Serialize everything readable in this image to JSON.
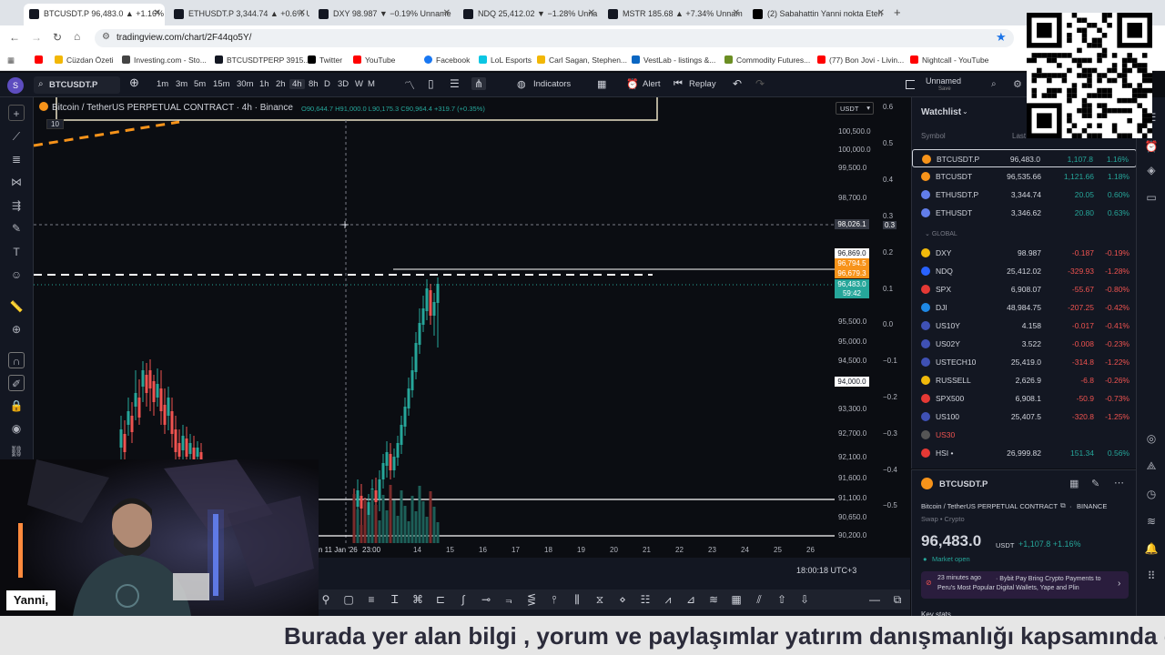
{
  "browser": {
    "tabs": [
      {
        "label": "BTCUSDT.P 96,483.0 ▲ +1.16%",
        "active": true
      },
      {
        "label": "ETHUSDT.P 3,344.74 ▲ +0.6% U"
      },
      {
        "label": "DXY 98.987 ▼ −0.19% Unname"
      },
      {
        "label": "NDQ 25,412.02 ▼ −1.28% Unna"
      },
      {
        "label": "MSTR 185.68 ▲ +7.34% Unnam"
      },
      {
        "label": "(2) Sabahattin Yanni nokta Eteh"
      }
    ],
    "url": "tradingview.com/chart/2F44qo5Y/",
    "bookmarks": [
      "Cüzdan Özeti",
      "Investing.com - Sto...",
      "BTCUSDTPERP 3915...",
      "Twitter",
      "YouTube",
      "Facebook",
      "LoL Esports",
      "Carl Sagan, Stephen...",
      "VestLab - listings &...",
      "Commodity Futures...",
      "(77) Bon Jovi - Livin...",
      "Nightcall - YouTube"
    ]
  },
  "toolbar": {
    "symbol": "BTCUSDT.P",
    "intervals": [
      "1m",
      "3m",
      "5m",
      "15m",
      "30m",
      "1h",
      "2h",
      "4h",
      "8h",
      "D",
      "3D",
      "W",
      "M"
    ],
    "active_interval": "4h",
    "indicators": "Indicators",
    "alert": "Alert",
    "replay": "Replay",
    "layout_name": "Unnamed",
    "layout_sub": "Save"
  },
  "legend": {
    "title": "Bitcoin / TetherUS PERPETUAL CONTRACT · 4h · Binance",
    "ohlc": "O90,644.7 H91,000.0 L90,175.3 C90,964.4 +319.7 (+0.35%)",
    "sub": "10"
  },
  "price_axis": {
    "currency": "USDT",
    "labels": [
      "100,500.0",
      "100,000.0",
      "99,500.0",
      "98,700.0",
      "95,500.0",
      "95,000.0",
      "94,500.0",
      "93,300.0",
      "92,700.0",
      "92,100.0",
      "91,600.0",
      "91,100.0",
      "90,650.0",
      "90,200.0"
    ],
    "crosshair": "98,026.1",
    "level_a": "96,869.0",
    "level_b": "96,794.5",
    "level_c": "96,679.3",
    "last": "96,483.0",
    "countdown": "59:42",
    "level_d": "94,000.0"
  },
  "right_scale": [
    "0.6",
    "0.5",
    "0.4",
    "0.3",
    "0.3",
    "0.2",
    "0.1",
    "0.0",
    "−0.1",
    "−0.2",
    "−0.3",
    "−0.4",
    "−0.5"
  ],
  "time_axis": {
    "labels": [
      "n 11 Jan '26",
      "23:00",
      "14",
      "15",
      "16",
      "17",
      "18",
      "19",
      "20",
      "21",
      "22",
      "23",
      "24",
      "25",
      "26"
    ],
    "clock": "18:00:18 UTC+3"
  },
  "watchlist": {
    "title": "Watchlist",
    "col_symbol": "Symbol",
    "col_last": "Last",
    "group_global": "GLOBAL",
    "rows": [
      {
        "sym": "BTCUSDT.P",
        "last": "96,483.0",
        "chg": "1,107.8",
        "pct": "1.16%",
        "dir": "up",
        "color": "#f7931a"
      },
      {
        "sym": "BTCUSDT",
        "last": "96,535.66",
        "chg": "1,121.66",
        "pct": "1.18%",
        "dir": "up",
        "color": "#f7931a"
      },
      {
        "sym": "ETHUSDT.P",
        "last": "3,344.74",
        "chg": "20.05",
        "pct": "0.60%",
        "dir": "up",
        "color": "#627eea"
      },
      {
        "sym": "ETHUSDT",
        "last": "3,346.62",
        "chg": "20.80",
        "pct": "0.63%",
        "dir": "up",
        "color": "#627eea"
      }
    ],
    "global_rows": [
      {
        "sym": "DXY",
        "last": "98.987",
        "chg": "-0.187",
        "pct": "-0.19%",
        "dir": "dn",
        "color": "#f0b90b"
      },
      {
        "sym": "NDQ",
        "last": "25,412.02",
        "chg": "-329.93",
        "pct": "-1.28%",
        "dir": "dn",
        "color": "#2962ff"
      },
      {
        "sym": "SPX",
        "last": "6,908.07",
        "chg": "-55.67",
        "pct": "-0.80%",
        "dir": "dn",
        "color": "#e53935"
      },
      {
        "sym": "DJI",
        "last": "48,984.75",
        "chg": "-207.25",
        "pct": "-0.42%",
        "dir": "dn",
        "color": "#1e88e5"
      },
      {
        "sym": "US10Y",
        "last": "4.158",
        "chg": "-0.017",
        "pct": "-0.41%",
        "dir": "dn",
        "color": "#3f51b5"
      },
      {
        "sym": "US02Y",
        "last": "3.522",
        "chg": "-0.008",
        "pct": "-0.23%",
        "dir": "dn",
        "color": "#3f51b5"
      },
      {
        "sym": "USTECH10",
        "last": "25,419.0",
        "chg": "-314.8",
        "pct": "-1.22%",
        "dir": "dn",
        "color": "#3f51b5"
      },
      {
        "sym": "RUSSELL",
        "last": "2,626.9",
        "chg": "-6.8",
        "pct": "-0.26%",
        "dir": "dn",
        "color": "#f0b90b"
      },
      {
        "sym": "SPX500",
        "last": "6,908.1",
        "chg": "-50.9",
        "pct": "-0.73%",
        "dir": "dn",
        "color": "#e53935"
      },
      {
        "sym": "US100",
        "last": "25,407.5",
        "chg": "-320.8",
        "pct": "-1.25%",
        "dir": "dn",
        "color": "#3f51b5"
      },
      {
        "sym": "US30",
        "last": "",
        "chg": "",
        "pct": "",
        "dir": "dn",
        "color": "#555"
      },
      {
        "sym": "HSI •",
        "last": "26,999.82",
        "chg": "151.34",
        "pct": "0.56%",
        "dir": "up",
        "color": "#e53935"
      }
    ]
  },
  "detail": {
    "symbol": "BTCUSDT.P",
    "full_name": "Bitcoin / TetherUS PERPETUAL CONTRACT",
    "exchange": "BINANCE",
    "type": "Swap • Crypto",
    "price": "96,483.0",
    "currency": "USDT",
    "change": "+1,107.8 +1.16%",
    "status": "Market open",
    "news_time": "23 minutes ago",
    "news_text": "· Bybit Pay Bring Crypto Payments to Peru's Most Popular Digital Wallets, Yape and Plin",
    "key_stats": "Key stats"
  },
  "webcam": {
    "caption": "Yanni,"
  },
  "ticker": {
    "text": "Burada yer alan bilgi , yorum ve paylaşımlar yatırım danışmanlığı kapsamında değ"
  },
  "colors": {
    "up": "#26a69a",
    "down": "#ef5350",
    "bg": "#0b0d12",
    "panel": "#131722"
  }
}
